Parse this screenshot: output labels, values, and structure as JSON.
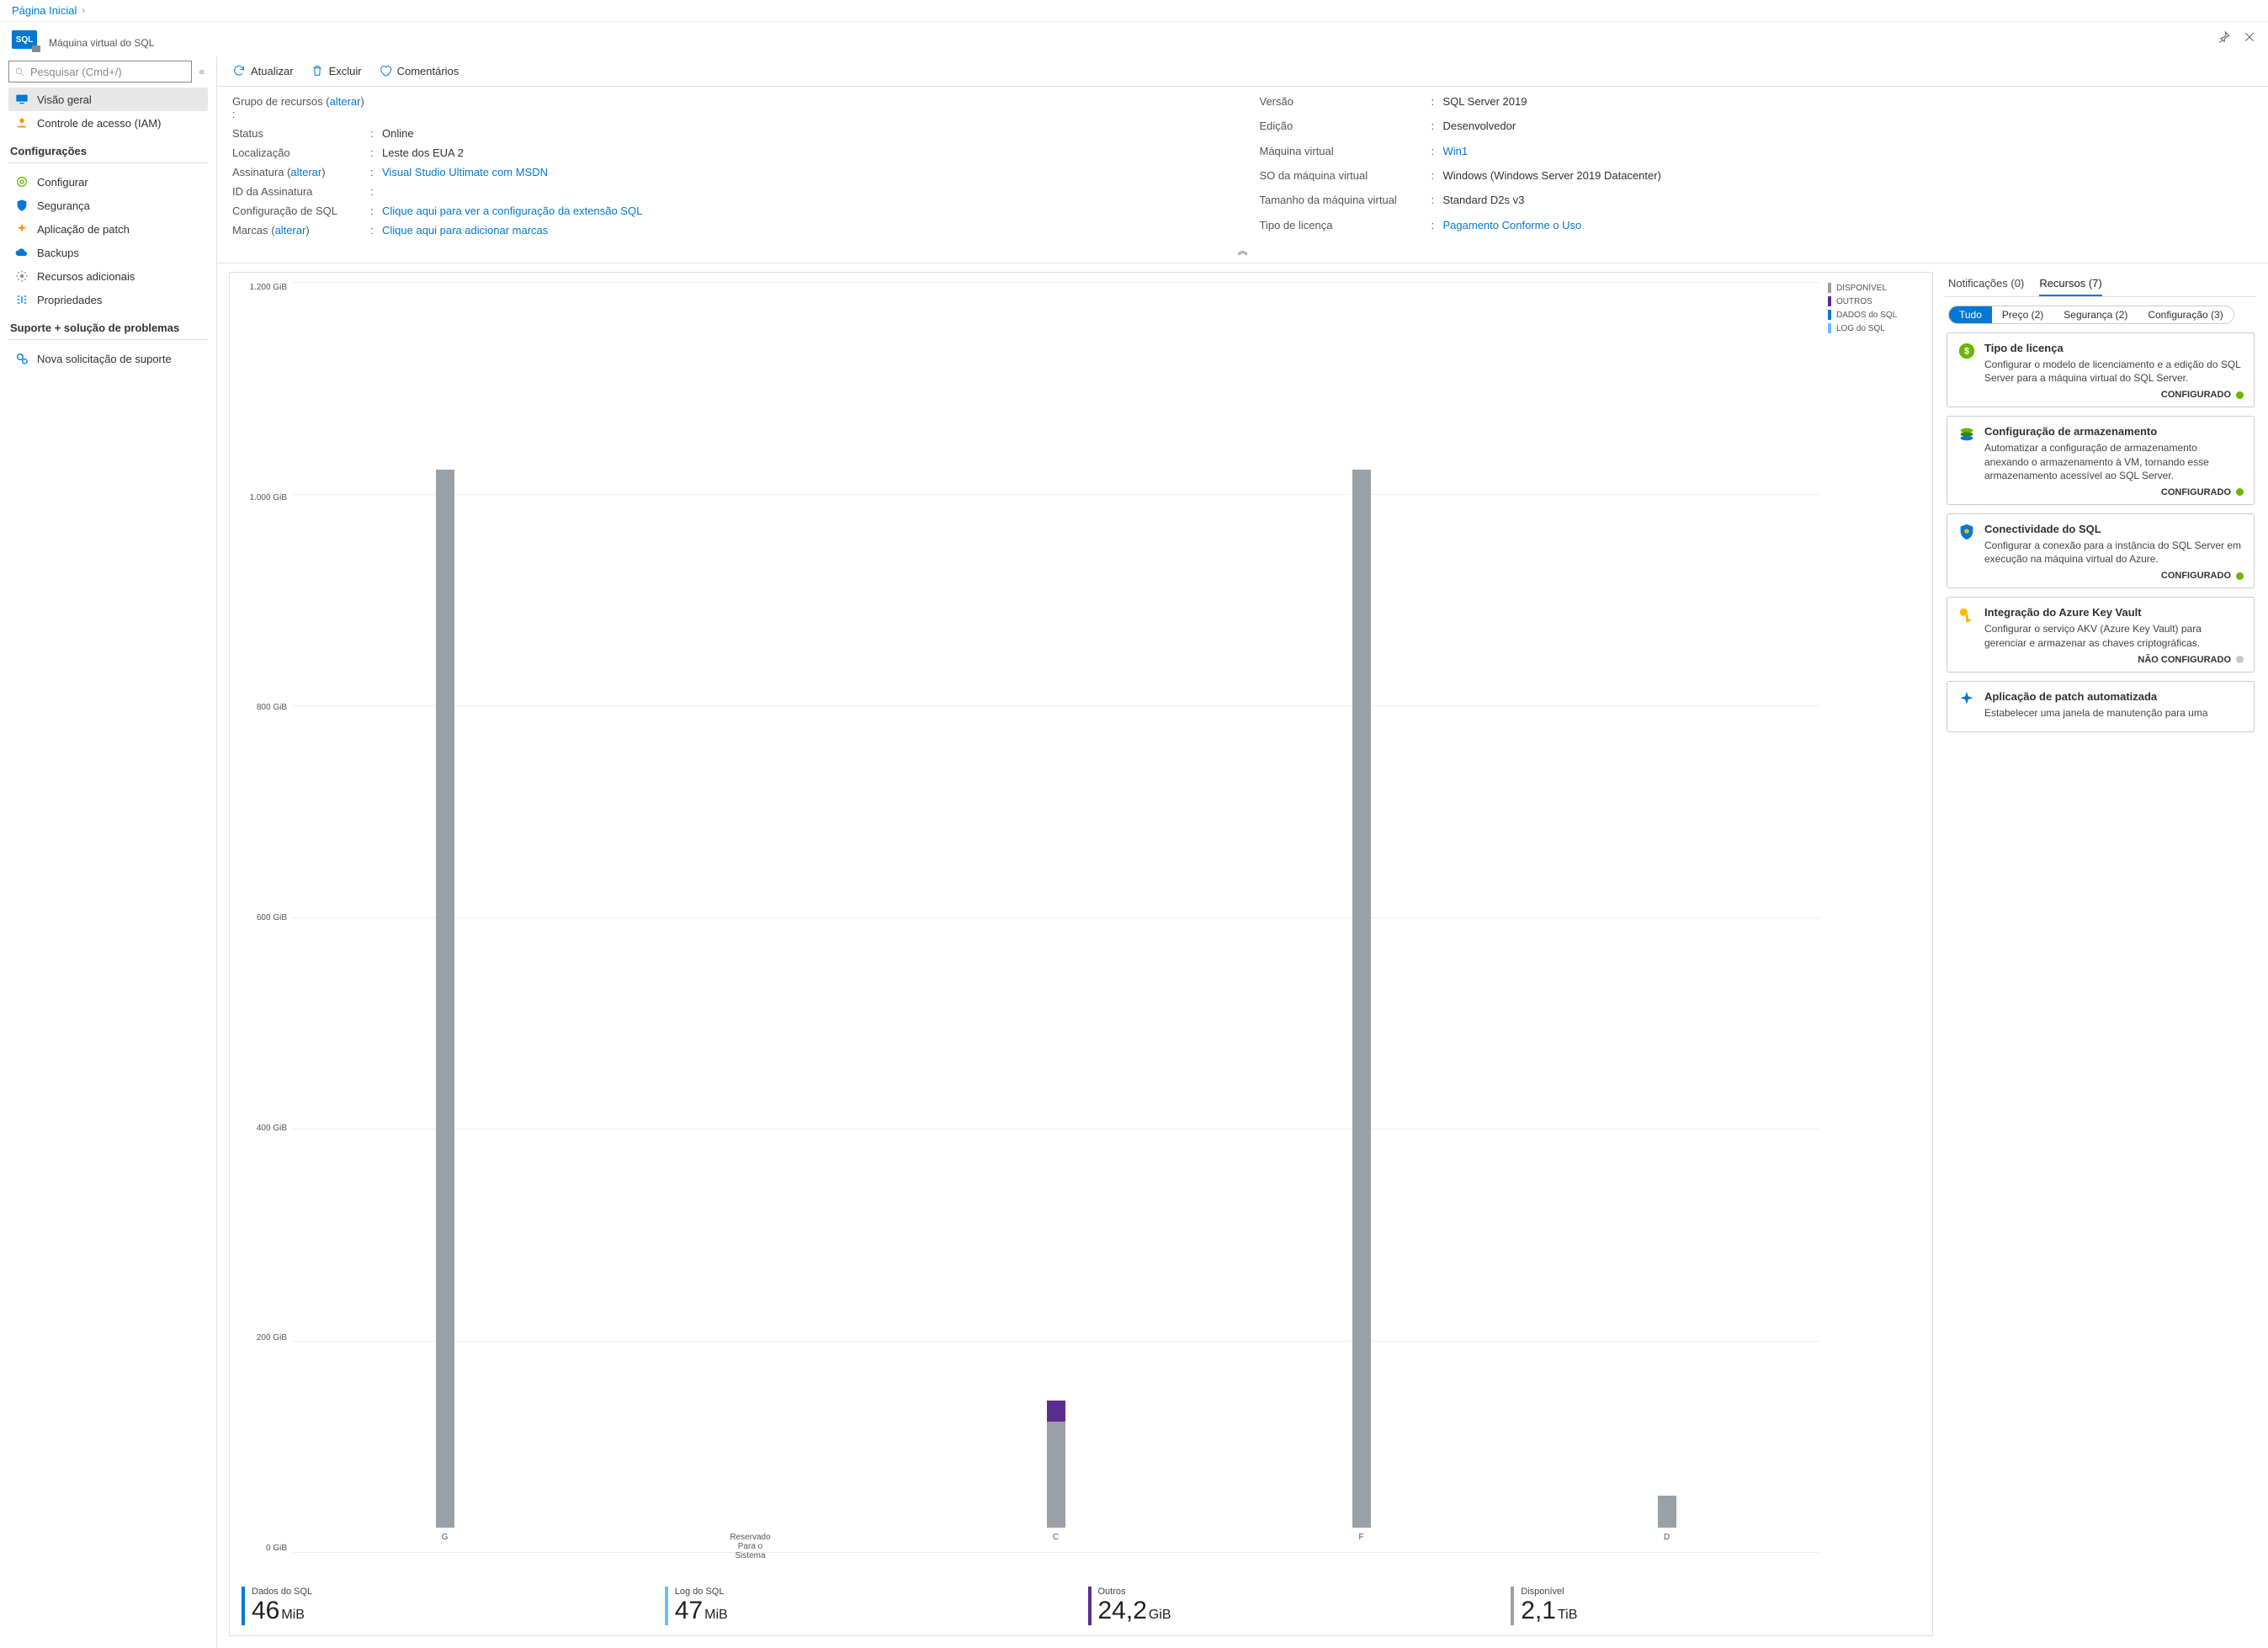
{
  "breadcrumb": {
    "home": "Página Inicial"
  },
  "header": {
    "subtitle": "Máquina virtual do SQL"
  },
  "search": {
    "placeholder": "Pesquisar (Cmd+/)"
  },
  "sidebar": {
    "overview": "Visão geral",
    "iam": "Controle de acesso (IAM)",
    "group_settings": "Configurações",
    "configure": "Configurar",
    "security": "Segurança",
    "patch": "Aplicação de patch",
    "backups": "Backups",
    "addl": "Recursos adicionais",
    "props": "Propriedades",
    "group_support": "Suporte + solução de problemas",
    "support_req": "Nova solicitação de suporte"
  },
  "toolbar": {
    "refresh": "Atualizar",
    "delete": "Excluir",
    "feedback": "Comentários"
  },
  "props": {
    "left": {
      "rg_label": "Grupo de recursos (",
      "rg_change": "alterar",
      "rg_after": ") :",
      "status_label": "Status",
      "status_value": "Online",
      "loc_label": "Localização",
      "loc_value": "Leste dos EUA 2",
      "sub_label": "Assinatura (",
      "sub_change": "alterar",
      "sub_after": ")",
      "sub_link": "Visual Studio Ultimate com MSDN",
      "subid_label": "ID da Assinatura",
      "subid_value": "",
      "sqlcfg_label": "Configuração de SQL",
      "sqlcfg_link": "Clique aqui para ver a configuração da extensão SQL",
      "tags_label": "Marcas (",
      "tags_change": "alterar",
      "tags_after": ")",
      "tags_link": "Clique aqui para adicionar marcas"
    },
    "right": {
      "version_label": "Versão",
      "version_value": "SQL Server 2019",
      "edition_label": "Edição",
      "edition_value": "Desenvolvedor",
      "vm_label": "Máquina virtual",
      "vm_link": "Win1",
      "os_label": "SO da máquina virtual",
      "os_value": "Windows (Windows Server 2019 Datacenter)",
      "size_label": "Tamanho da máquina virtual",
      "size_value": "Standard D2s v3",
      "lic_label": "Tipo de licença",
      "lic_link": "Pagamento Conforme o Uso"
    }
  },
  "chart_data": {
    "type": "bar",
    "ylabel": "GiB",
    "ylim": [
      0,
      1200
    ],
    "yticks": [
      "0 GiB",
      "200 GiB",
      "400 GiB",
      "600 GiB",
      "800 GiB",
      "1.000 GiB",
      "1.200 GiB"
    ],
    "categories": [
      "G",
      "Reservado Para o Sistema",
      "C",
      "F",
      "D"
    ],
    "series": [
      {
        "name": "DISPONÍVEL",
        "color": "#9aa0a8",
        "values": [
          1000,
          0,
          100,
          1000,
          30
        ]
      },
      {
        "name": "OUTROS",
        "color": "#5c2d91",
        "values": [
          0,
          0,
          20,
          0,
          0
        ]
      },
      {
        "name": "DADOS do SQL",
        "color": "#0078d4",
        "values": [
          0,
          0,
          0,
          0,
          0
        ]
      },
      {
        "name": "LOG do SQL",
        "color": "#69c0ff",
        "values": [
          0,
          0,
          0,
          0,
          0
        ]
      }
    ],
    "legend": [
      "DISPONÍVEL",
      "OUTROS",
      "DADOS do SQL",
      "LOG do SQL"
    ]
  },
  "metrics": [
    {
      "label": "Dados do SQL",
      "value": "46",
      "unit": "MiB",
      "color": "#0078d4"
    },
    {
      "label": "Log do SQL",
      "value": "47",
      "unit": "MiB",
      "color": "#69c0ff"
    },
    {
      "label": "Outros",
      "value": "24,2",
      "unit": "GiB",
      "color": "#5c2d91"
    },
    {
      "label": "Disponível",
      "value": "2,1",
      "unit": "TiB",
      "color": "#9aa0a8"
    }
  ],
  "rp": {
    "tab_notif": "Notificações (0)",
    "tab_res": "Recursos (7)",
    "pill_all": "Tudo",
    "pill_price": "Preço (2)",
    "pill_sec": "Segurança (2)",
    "pill_cfg": "Configuração (3)"
  },
  "cards": [
    {
      "icon": "dollar",
      "title": "Tipo de licença",
      "desc": "Configurar o modelo de licenciamento e a edição do SQL Server para a máquina virtual do SQL Server.",
      "status": "CONFIGURADO",
      "dot": "green"
    },
    {
      "icon": "stack",
      "title": "Configuração de armazenamento",
      "desc": "Automatizar a configuração de armazenamento anexando o armazenamento à VM, tornando esse armazenamento acessível ao SQL Server.",
      "status": "CONFIGURADO",
      "dot": "green"
    },
    {
      "icon": "shield",
      "title": "Conectividade do SQL",
      "desc": "Configurar a conexão para a instância do SQL Server em execução na máquina virtual do Azure.",
      "status": "CONFIGURADO",
      "dot": "green"
    },
    {
      "icon": "key",
      "title": "Integração do Azure Key Vault",
      "desc": "Configurar o serviço AKV (Azure Key Vault) para gerenciar e armazenar as chaves criptográficas.",
      "status": "NÃO CONFIGURADO",
      "dot": "gray"
    },
    {
      "icon": "gear",
      "title": "Aplicação de patch automatizada",
      "desc": "Estabelecer uma janela de manutenção para uma",
      "status": "",
      "dot": ""
    }
  ]
}
